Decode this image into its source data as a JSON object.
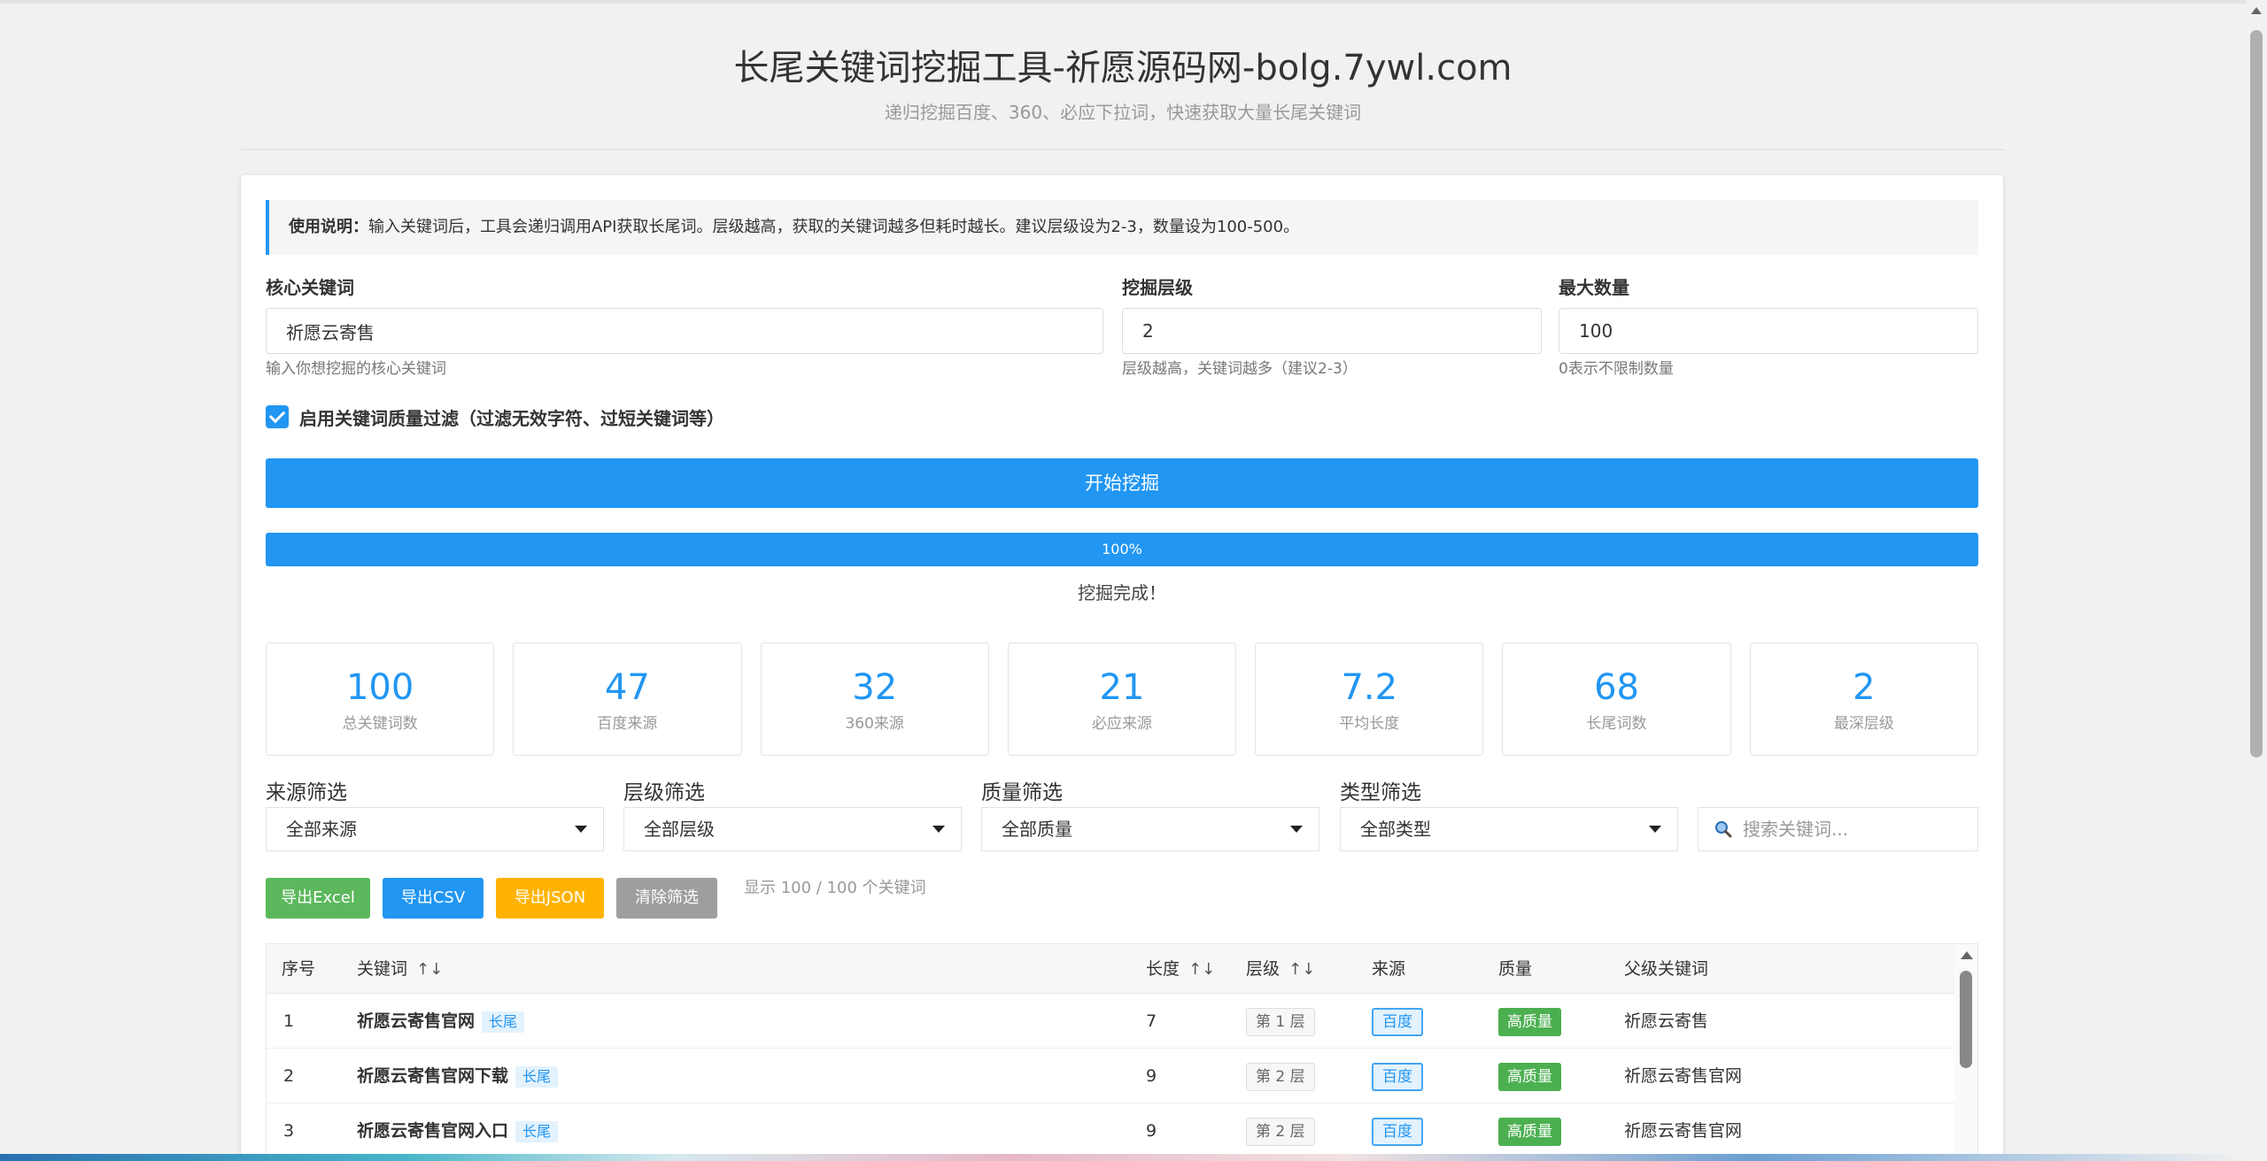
{
  "header": {
    "title": "长尾关键词挖掘工具-祈愿源码网-bolg.7ywl.com",
    "subtitle": "递归挖掘百度、360、必应下拉词，快速获取大量长尾关键词"
  },
  "notice": {
    "label": "使用说明：",
    "text": "输入关键词后，工具会递归调用API获取长尾词。层级越高，获取的关键词越多但耗时越长。建议层级设为2-3，数量设为100-500。"
  },
  "form": {
    "keyword": {
      "label": "核心关键词",
      "value": "祈愿云寄售",
      "help": "输入你想挖掘的核心关键词"
    },
    "depth": {
      "label": "挖掘层级",
      "value": "2",
      "help": "层级越高，关键词越多（建议2-3）"
    },
    "max": {
      "label": "最大数量",
      "value": "100",
      "help": "0表示不限制数量"
    },
    "quality_filter": {
      "label": "启用关键词质量过滤（过滤无效字符、过短关键词等）",
      "checked": true
    },
    "start_label": "开始挖掘"
  },
  "progress": {
    "percent": 100,
    "label": "100%",
    "status": "挖掘完成！"
  },
  "stats": [
    {
      "value": "100",
      "label": "总关键词数"
    },
    {
      "value": "47",
      "label": "百度来源"
    },
    {
      "value": "32",
      "label": "360来源"
    },
    {
      "value": "21",
      "label": "必应来源"
    },
    {
      "value": "7.2",
      "label": "平均长度"
    },
    {
      "value": "68",
      "label": "长尾词数"
    },
    {
      "value": "2",
      "label": "最深层级"
    }
  ],
  "filters": {
    "source": {
      "label": "来源筛选",
      "selected": "全部来源"
    },
    "level": {
      "label": "层级筛选",
      "selected": "全部层级"
    },
    "quality": {
      "label": "质量筛选",
      "selected": "全部质量"
    },
    "type": {
      "label": "类型筛选",
      "selected": "全部类型"
    },
    "search_placeholder": "搜索关键词..."
  },
  "actions": {
    "export_excel": "导出Excel",
    "export_csv": "导出CSV",
    "export_json": "导出JSON",
    "clear_filter": "清除筛选",
    "count_text": "显示 100 / 100 个关键词"
  },
  "colors": {
    "primary": "#2196f3",
    "excel": "#5cb85c",
    "json": "#ffb300",
    "clear": "#9e9e9e",
    "quality_high": "#4caf50"
  },
  "table": {
    "columns": {
      "index": "序号",
      "keyword": "关键词",
      "length": "长度",
      "level": "层级",
      "source": "来源",
      "quality": "质量",
      "parent": "父级关键词"
    },
    "sort_icon": "↑↓",
    "rows": [
      {
        "index": "1",
        "keyword": "祈愿云寄售官网",
        "tag": "长尾",
        "length": "7",
        "level": "第 1 层",
        "source": "百度",
        "quality": "高质量",
        "parent": "祈愿云寄售"
      },
      {
        "index": "2",
        "keyword": "祈愿云寄售官网下载",
        "tag": "长尾",
        "length": "9",
        "level": "第 2 层",
        "source": "百度",
        "quality": "高质量",
        "parent": "祈愿云寄售官网"
      },
      {
        "index": "3",
        "keyword": "祈愿云寄售官网入口",
        "tag": "长尾",
        "length": "9",
        "level": "第 2 层",
        "source": "百度",
        "quality": "高质量",
        "parent": "祈愿云寄售官网"
      }
    ]
  }
}
